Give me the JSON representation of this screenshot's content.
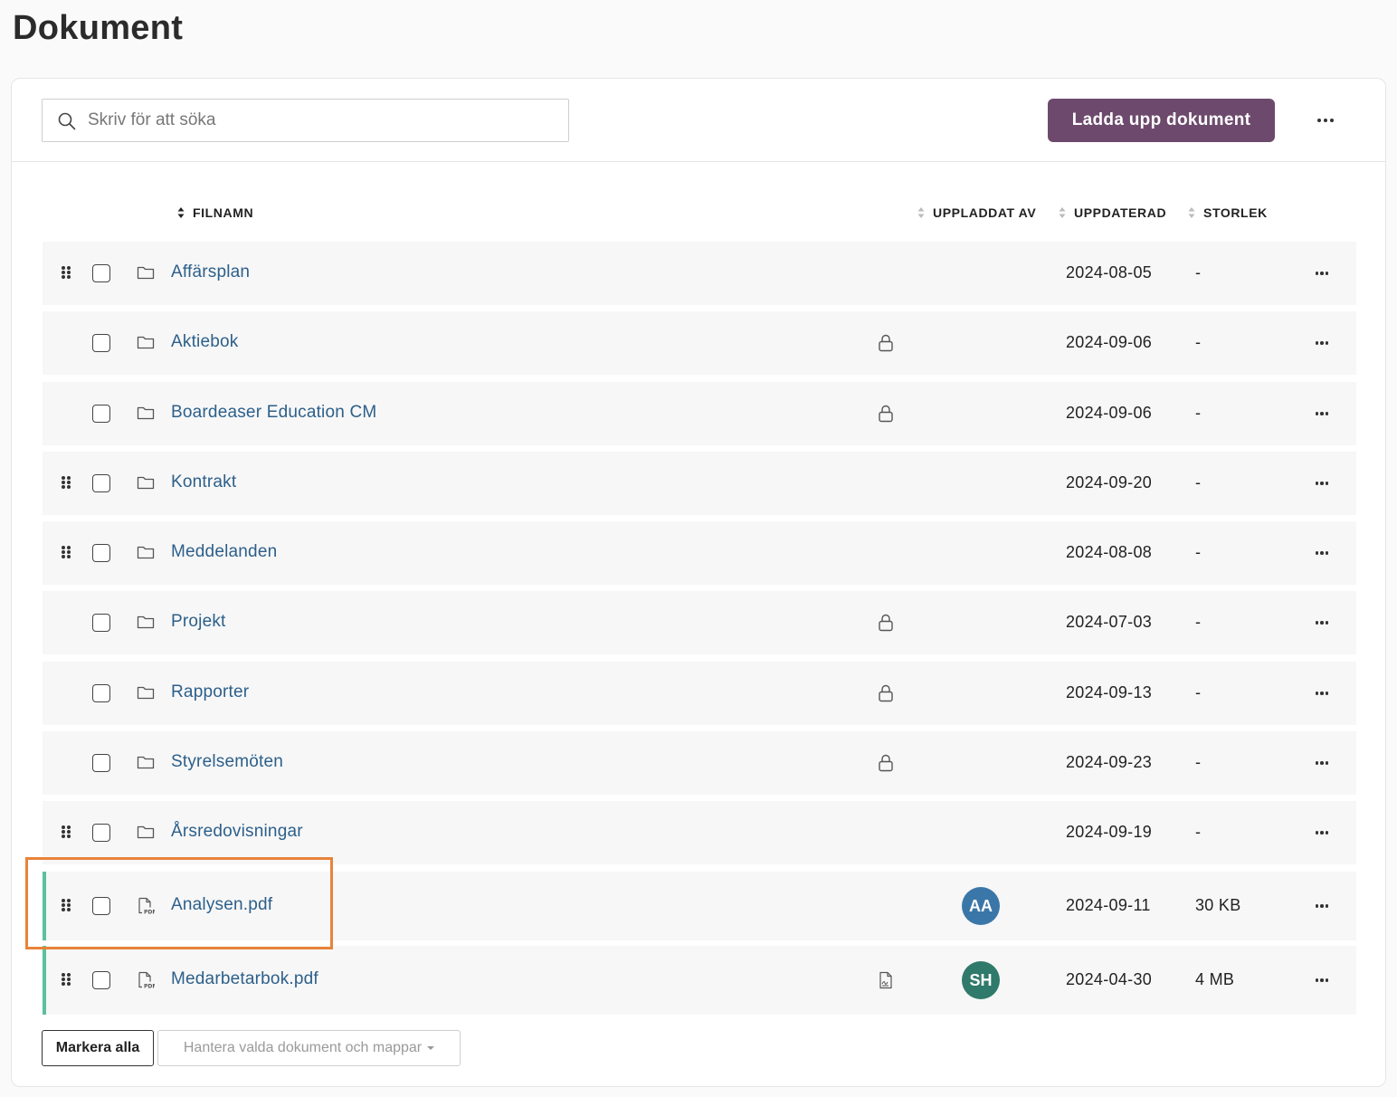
{
  "page": {
    "title": "Dokument"
  },
  "toolbar": {
    "search_placeholder": "Skriv för att söka",
    "upload_label": "Ladda upp dokument"
  },
  "table": {
    "columns": {
      "filename": "FILNAMN",
      "uploaded_by": "UPPLADDAT AV",
      "updated": "UPPDATERAD",
      "size": "STORLEK"
    },
    "rows": [
      {
        "type": "folder",
        "name": "Affärsplan",
        "draggable": true,
        "locked": false,
        "updated": "2024-08-05",
        "size": "-"
      },
      {
        "type": "folder",
        "name": "Aktiebok",
        "draggable": false,
        "locked": true,
        "updated": "2024-09-06",
        "size": "-"
      },
      {
        "type": "folder",
        "name": "Boardeaser Education CM",
        "draggable": false,
        "locked": true,
        "updated": "2024-09-06",
        "size": "-"
      },
      {
        "type": "folder",
        "name": "Kontrakt",
        "draggable": true,
        "locked": false,
        "updated": "2024-09-20",
        "size": "-"
      },
      {
        "type": "folder",
        "name": "Meddelanden",
        "draggable": true,
        "locked": false,
        "updated": "2024-08-08",
        "size": "-"
      },
      {
        "type": "folder",
        "name": "Projekt",
        "draggable": false,
        "locked": true,
        "updated": "2024-07-03",
        "size": "-"
      },
      {
        "type": "folder",
        "name": "Rapporter",
        "draggable": false,
        "locked": true,
        "updated": "2024-09-13",
        "size": "-"
      },
      {
        "type": "folder",
        "name": "Styrelsemöten",
        "draggable": false,
        "locked": true,
        "updated": "2024-09-23",
        "size": "-"
      },
      {
        "type": "folder",
        "name": "Årsredovisningar",
        "draggable": true,
        "locked": false,
        "updated": "2024-09-19",
        "size": "-"
      },
      {
        "type": "pdf",
        "name": "Analysen.pdf",
        "draggable": true,
        "uploader_initials": "AA",
        "avatar_color": "#3a77a8",
        "updated": "2024-09-11",
        "size": "30 KB"
      },
      {
        "type": "pdf",
        "name": "Medarbetarbok.pdf",
        "draggable": true,
        "signed": true,
        "uploader_initials": "SH",
        "avatar_color": "#2f7a6a",
        "updated": "2024-04-30",
        "size": "4 MB"
      }
    ]
  },
  "footer": {
    "select_all_label": "Markera alla",
    "manage_label": "Hantera valda dokument och mappar"
  },
  "colors": {
    "accent": "#6d4a6d",
    "link": "#2c5f8a",
    "row_marker": "#5cc0a0",
    "highlight": "#e8833a"
  }
}
